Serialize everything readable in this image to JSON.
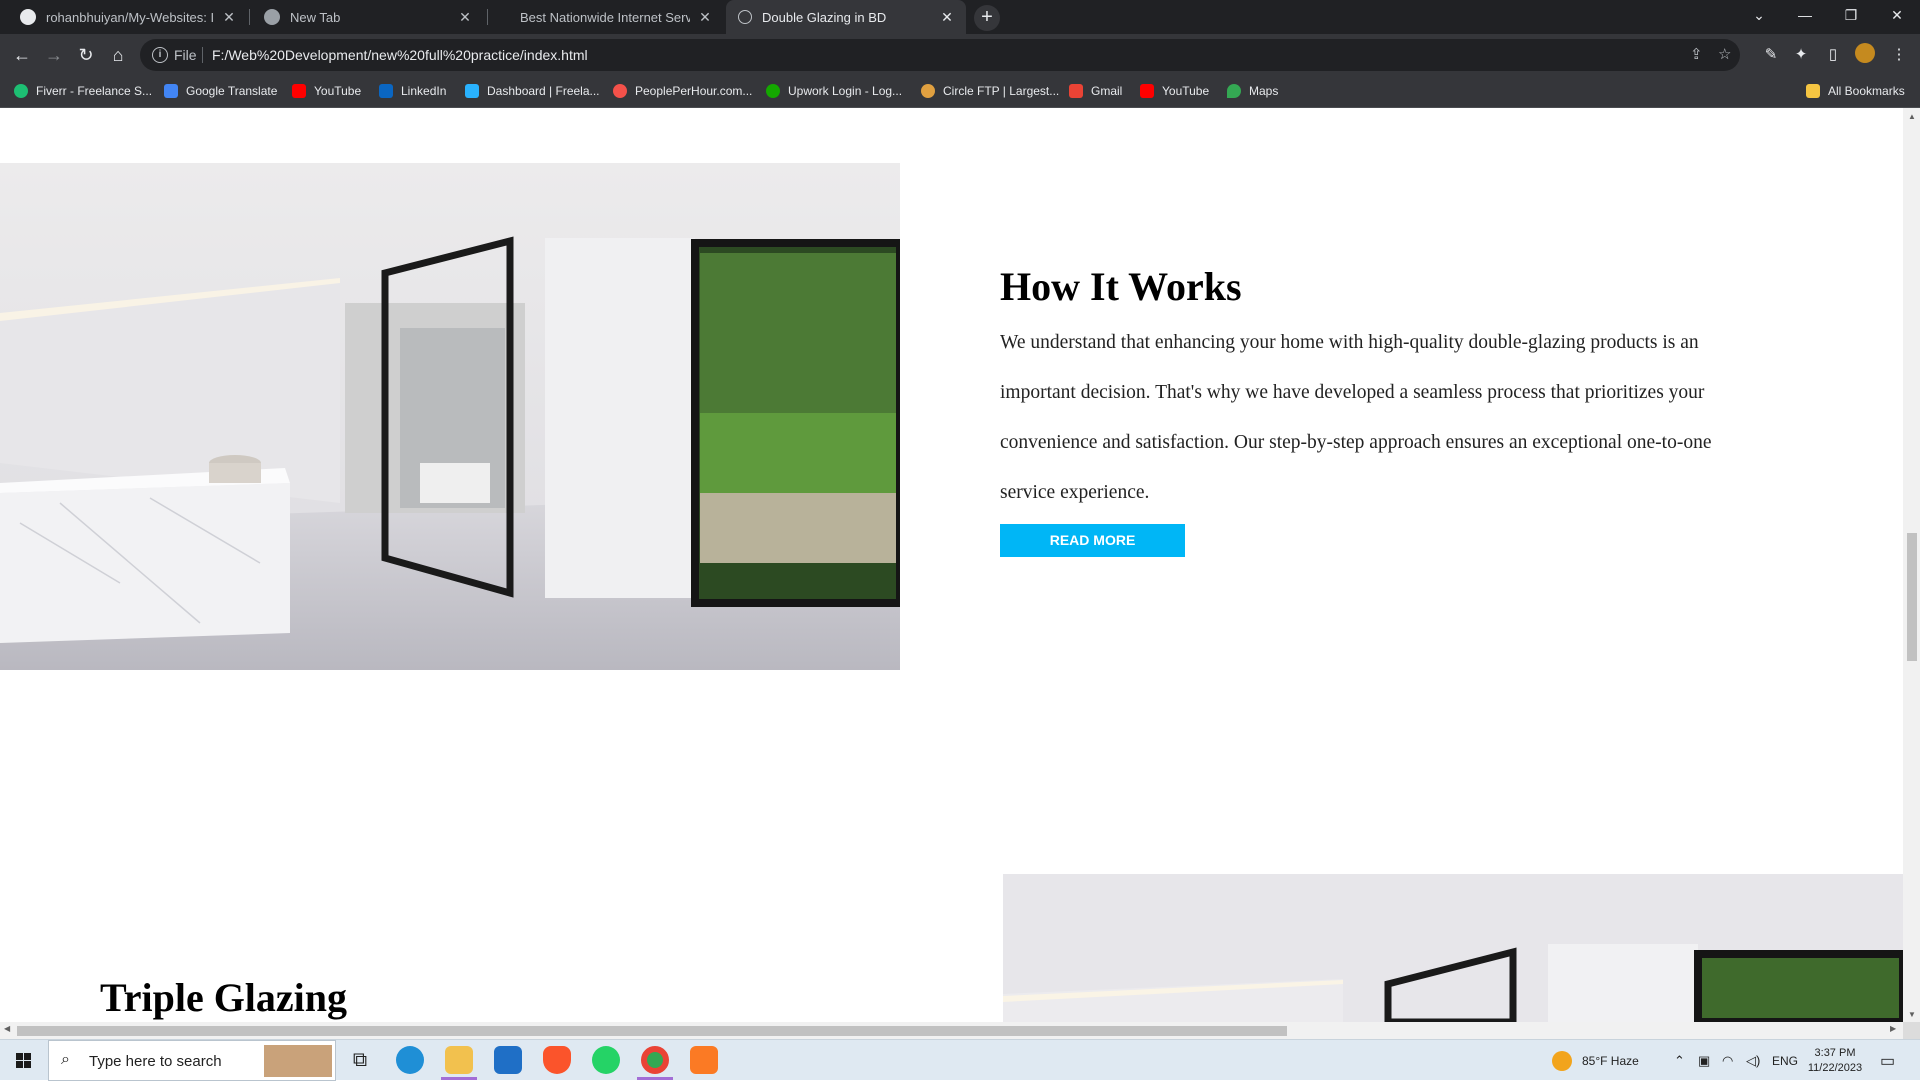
{
  "browser": {
    "tabs": [
      {
        "title": "rohanbhuiyan/My-Websites: I ha",
        "active": false,
        "favicon": "github-icon"
      },
      {
        "title": "New Tab",
        "active": false,
        "favicon": "chrome-icon"
      },
      {
        "title": "Best Nationwide Internet Service",
        "active": false,
        "favicon": "globe-icon"
      },
      {
        "title": "Double Glazing in BD",
        "active": true,
        "favicon": "globe-icon"
      }
    ],
    "address": {
      "scheme_label": "File",
      "url": "F:/Web%20Development/new%20full%20practice/index.html"
    },
    "bookmarks": [
      {
        "label": "Fiverr - Freelance S...",
        "color": "#1dbf73"
      },
      {
        "label": "Google Translate",
        "color": "#4285f4"
      },
      {
        "label": "YouTube",
        "color": "#ff0000"
      },
      {
        "label": "LinkedIn",
        "color": "#0a66c2"
      },
      {
        "label": "Dashboard | Freela...",
        "color": "#29b2fe"
      },
      {
        "label": "PeoplePerHour.com...",
        "color": "#f4514a"
      },
      {
        "label": "Upwork Login - Log...",
        "color": "#14a800"
      },
      {
        "label": "Circle FTP | Largest...",
        "color": "#e0a040"
      },
      {
        "label": "Gmail",
        "color": "#ea4335"
      },
      {
        "label": "YouTube",
        "color": "#ff0000"
      },
      {
        "label": "Maps",
        "color": "#34a853"
      }
    ],
    "all_bookmarks_label": "All Bookmarks"
  },
  "page": {
    "how_it_works": {
      "title": "How It Works",
      "body": "We understand that enhancing your home with high-quality double-glazing products is an important decision. That's why we have developed a seamless process that prioritizes your convenience and satisfaction. Our step-by-step approach ensures an exceptional one-to-one service experience.",
      "button_label": "READ MORE",
      "button_color": "#00b6f6"
    },
    "triple_glazing": {
      "title": "Triple Glazing"
    }
  },
  "taskbar": {
    "search_placeholder": "Type here to search",
    "weather": "85°F  Haze",
    "language": "ENG",
    "time": "3:37 PM",
    "date": "11/22/2023"
  }
}
